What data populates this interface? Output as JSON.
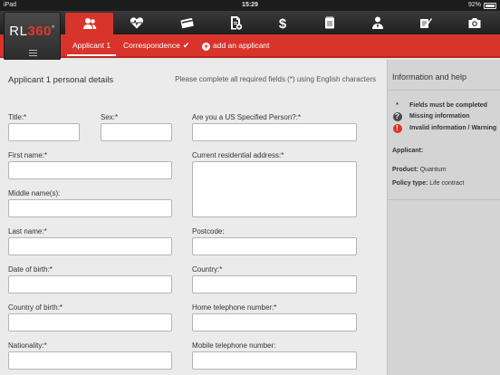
{
  "status": {
    "device": "iPad",
    "time": "15:29",
    "battery": "92%"
  },
  "logo": {
    "text_main": "RL",
    "text_num": "360",
    "mark": "°"
  },
  "nav": {
    "tabs": [
      {
        "icon": "people-icon"
      },
      {
        "icon": "heartbeat-icon"
      },
      {
        "icon": "card-icon"
      },
      {
        "icon": "document-add-icon"
      },
      {
        "icon": "dollar-icon"
      },
      {
        "icon": "notepad-icon"
      },
      {
        "icon": "advisor-icon"
      },
      {
        "icon": "signature-icon"
      },
      {
        "icon": "camera-icon"
      }
    ]
  },
  "subnav": {
    "applicant": "Applicant 1",
    "correspondence": "Correspondence",
    "check": "✔",
    "add": "add an applicant"
  },
  "form": {
    "title": "Applicant 1 personal details",
    "hint": "Please complete all required fields (*) using English characters",
    "labels": {
      "title": "Title:*",
      "sex": "Sex:*",
      "us_person": "Are you a US Specified Person?:*",
      "first_name": "First name:*",
      "address": "Current residential address:*",
      "middle_names": "Middle name(s):",
      "last_name": "Last name:*",
      "postcode": "Postcode:",
      "dob": "Date of birth:*",
      "country": "Country:*",
      "country_birth": "Country of birth:*",
      "home_phone": "Home telephone number:*",
      "nationality": "Nationality:*",
      "mobile_phone": "Mobile telephone number:"
    }
  },
  "side": {
    "title": "Information and help",
    "legend": [
      {
        "symbol": "*",
        "text": "Fields must be completed"
      },
      {
        "symbol": "?",
        "text": "Missing information"
      },
      {
        "symbol": "!",
        "text": "Invalid information / Warning"
      }
    ],
    "applicant_label": "Applicant:",
    "product_label": "Product:",
    "product_value": "Quantum",
    "policy_label": "Policy type:",
    "policy_value": "Life contract"
  },
  "colors": {
    "accent": "#d8342b",
    "dark": "#2a2a2a",
    "panel": "#d4d4d4"
  }
}
